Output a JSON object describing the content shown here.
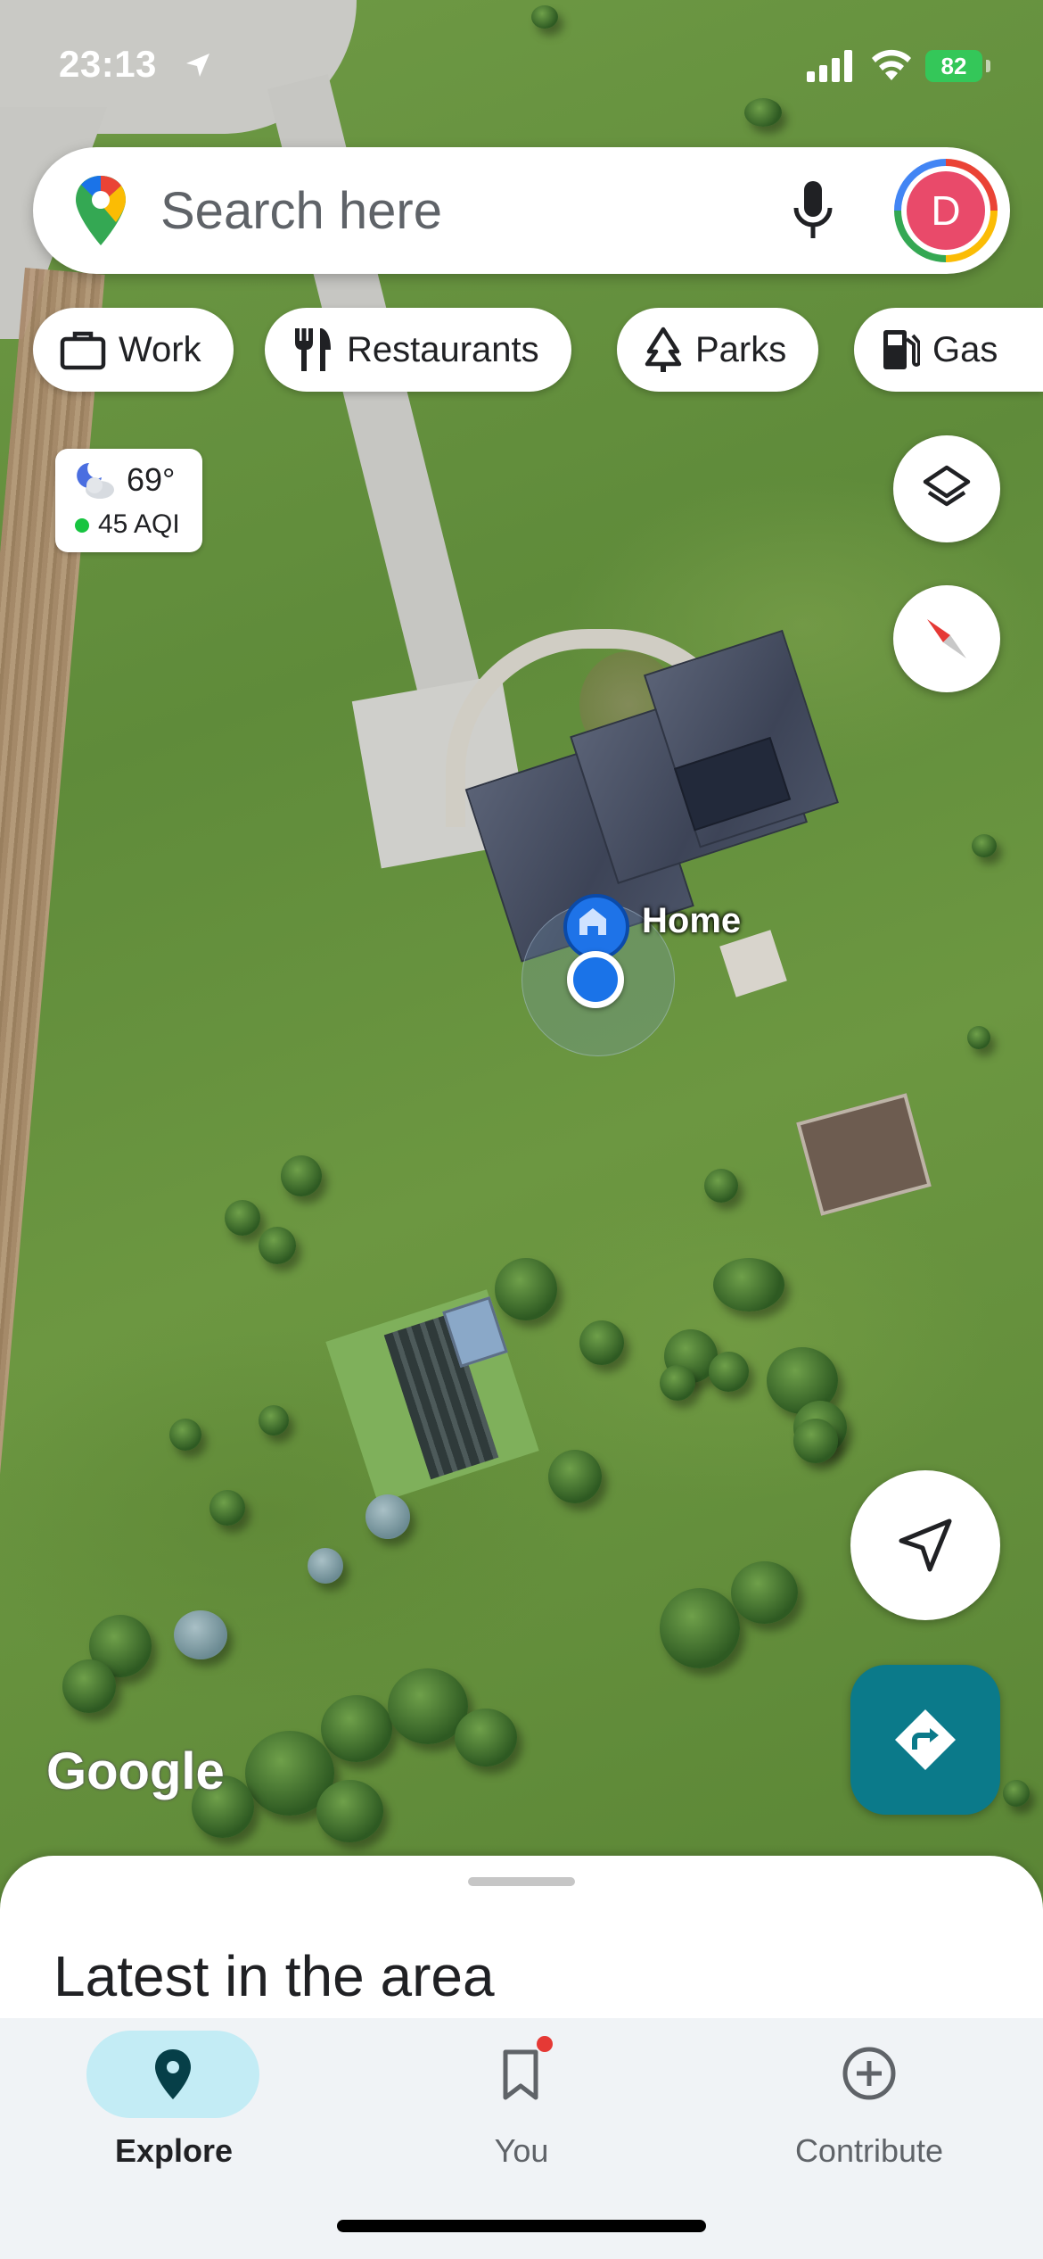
{
  "status_bar": {
    "time": "23:13",
    "battery": "82"
  },
  "search": {
    "placeholder": "Search here",
    "avatar_initial": "D"
  },
  "chips": [
    {
      "label": "Work",
      "icon": "briefcase-icon"
    },
    {
      "label": "Restaurants",
      "icon": "fork-knife-icon"
    },
    {
      "label": "Parks",
      "icon": "tree-icon"
    },
    {
      "label": "Gas",
      "icon": "gas-pump-icon"
    }
  ],
  "weather": {
    "temperature": "69°",
    "aqi": "45 AQI",
    "aqi_color": "#17c440"
  },
  "map": {
    "place_label": "Home",
    "attribution": "Google"
  },
  "sheet": {
    "title": "Latest in the area"
  },
  "nav": {
    "items": [
      {
        "label": "Explore",
        "icon": "pin-icon",
        "active": true
      },
      {
        "label": "You",
        "icon": "bookmark-icon",
        "active": false
      },
      {
        "label": "Contribute",
        "icon": "plus-circle-icon",
        "active": false
      }
    ]
  },
  "colors": {
    "accent": "#0b7a8a",
    "explore_pill": "#c3ecf5",
    "location_blue": "#1a73e8"
  }
}
